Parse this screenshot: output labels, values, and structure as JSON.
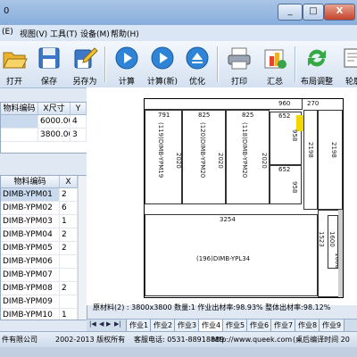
{
  "window": {
    "title": "0",
    "minimize": "_",
    "maximize": "□",
    "close": "X"
  },
  "menu": [
    {
      "label": "(E)"
    },
    {
      "label": "视图(V)"
    },
    {
      "label": "工具(T)"
    },
    {
      "label": "设备(M)"
    },
    {
      "label": "帮助(H)"
    }
  ],
  "toolbar": [
    {
      "label": "打开",
      "icon": "folder-open-icon"
    },
    {
      "label": "保存",
      "icon": "floppy-disk-icon"
    },
    {
      "label": "另存为",
      "icon": "save-as-icon"
    },
    {
      "label": "计算",
      "icon": "play-icon"
    },
    {
      "label": "计算(新)",
      "icon": "play-icon"
    },
    {
      "label": "优化",
      "icon": "eject-icon"
    },
    {
      "label": "打印",
      "icon": "printer-icon"
    },
    {
      "label": "汇总",
      "icon": "summary-icon"
    },
    {
      "label": "布局调整",
      "icon": "refresh-icon"
    },
    {
      "label": "轮廓",
      "icon": "outline-icon"
    }
  ],
  "materials_table": {
    "headers": [
      "物料编码",
      "X尺寸",
      "Y"
    ],
    "rows": [
      {
        "code": "",
        "x": "6000.00",
        "y": "4"
      },
      {
        "code": "",
        "x": "3800.00",
        "y": "3"
      }
    ]
  },
  "parts_table": {
    "headers": [
      "物料编码",
      "X"
    ],
    "rows": [
      {
        "code": "DIMB-YPM01",
        "x": "2"
      },
      {
        "code": "DIMB-YPM02",
        "x": "6"
      },
      {
        "code": "DIMB-YPM03",
        "x": "1"
      },
      {
        "code": "DIMB-YPM04",
        "x": "2"
      },
      {
        "code": "DIMB-YPM05",
        "x": "2"
      },
      {
        "code": "DIMB-YPM06",
        "x": ""
      },
      {
        "code": "DIMB-YPM07",
        "x": ""
      },
      {
        "code": "DIMB-YPM08",
        "x": "2"
      },
      {
        "code": "DIMB-YPM09",
        "x": ""
      },
      {
        "code": "DIMB-YPM10",
        "x": "1"
      }
    ]
  },
  "layout_labels": {
    "top_960": "960",
    "top_270": "270",
    "w_791": "791",
    "w_825a": "825",
    "w_825b": "825",
    "w_652a": "652",
    "w_652b": "652",
    "h_2020a": "2020",
    "h_2020b": "2020",
    "h_2020c": "2020",
    "h_2198": "2198",
    "h_958a": "958",
    "h_958b": "958",
    "w_3254": "3254",
    "h_1523": "1523",
    "h_1600a": "1600",
    "h_1600b": "1600",
    "part_a": "(119)DIMB-YPM19",
    "part_b": "(120)DIMB-YPM20",
    "part_c": "(118)DIMB-YPM20",
    "part_big": "(196)DIMB-YPL34"
  },
  "summary": {
    "text": "原材料(2) : 3800x3800  数量:1  作业出材率:98.93%  整体出材率:98.12%"
  },
  "sheet_tabs": [
    "作业1",
    "作业2",
    "作业3",
    "作业4",
    "作业5",
    "作业6",
    "作业7",
    "作业8",
    "作业9"
  ],
  "active_tab": "作业4",
  "statusbar": {
    "company": "件有限公司",
    "copyright": "2002-2013 版权所有",
    "phone": "客服电话: 0531-88918889",
    "url": "http://www.queek.com",
    "note": "(桌后编译时间 20"
  },
  "colors": {
    "accent_yellow": "#f2d800",
    "scrap_gray": "#d0d0d0",
    "selected_row": "#c9d9ee"
  }
}
